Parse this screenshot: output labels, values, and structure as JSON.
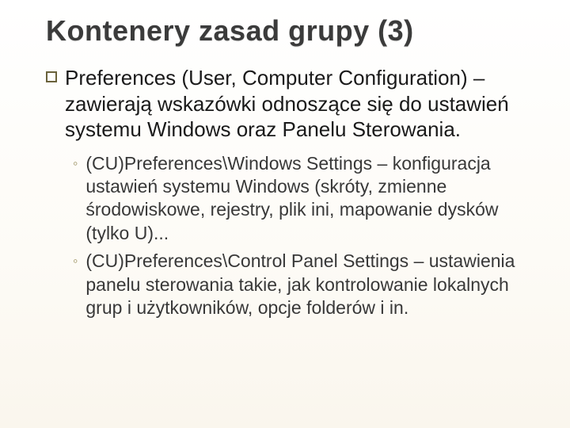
{
  "title": "Kontenery zasad grupy (3)",
  "bullets": [
    {
      "text": "Preferences (User, Computer Configuration) – zawierają wskazówki odnoszące się do ustawień systemu Windows oraz Panelu Sterowania.",
      "children": [
        {
          "text": "(CU)Preferences\\Windows Settings – konfiguracja ustawień systemu Windows (skróty, zmienne środowiskowe, rejestry, plik ini, mapowanie dysków (tylko U)..."
        },
        {
          "text": "(CU)Preferences\\Control Panel Settings – ustawienia panelu sterowania takie, jak kontrolowanie lokalnych grup i użytkowników, opcje folderów i in."
        }
      ]
    }
  ],
  "glyphs": {
    "sub_bullet": "◦"
  }
}
